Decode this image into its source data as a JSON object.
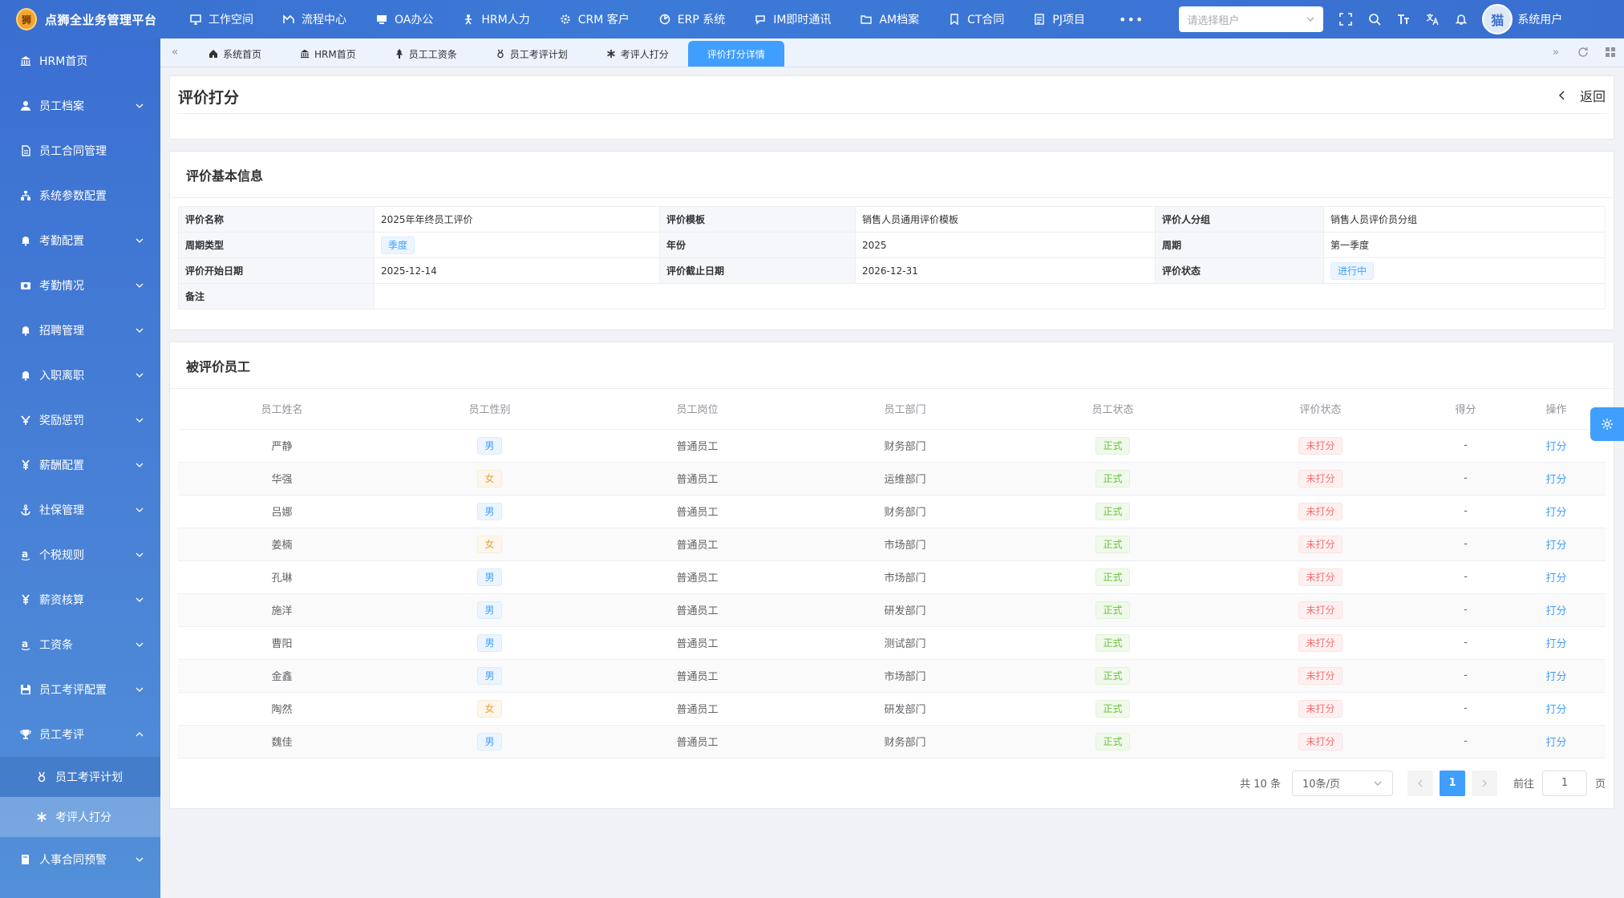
{
  "app": {
    "title": "点狮全业务管理平台",
    "logo_text": "狮"
  },
  "topnav": [
    {
      "icon": "monitor-icon",
      "label": "工作空间"
    },
    {
      "icon": "flow-icon",
      "label": "流程中心"
    },
    {
      "icon": "desktop-icon",
      "label": "OA办公"
    },
    {
      "icon": "person-icon",
      "label": "HRM人力"
    },
    {
      "icon": "gear-icon",
      "label": "CRM 客户"
    },
    {
      "icon": "chart-icon",
      "label": "ERP 系统"
    },
    {
      "icon": "chat-icon",
      "label": "IM即时通讯"
    },
    {
      "icon": "folder-icon",
      "label": "AM档案"
    },
    {
      "icon": "bookmark-icon",
      "label": "CT合同"
    },
    {
      "icon": "document-icon",
      "label": "PJ项目"
    }
  ],
  "more_label": "•••",
  "tenant": {
    "placeholder": "请选择租户"
  },
  "user": {
    "name": "系统用户",
    "avatar_text": "猫"
  },
  "sidebar": {
    "items": [
      {
        "icon": "bank-icon",
        "label": "HRM首页",
        "has_children": false
      },
      {
        "icon": "user-icon",
        "label": "员工档案",
        "has_children": true
      },
      {
        "icon": "file-icon",
        "label": "员工合同管理",
        "has_children": false
      },
      {
        "icon": "hierarchy-icon",
        "label": "系统参数配置",
        "has_children": false
      },
      {
        "icon": "bell-icon",
        "label": "考勤配置",
        "has_children": true
      },
      {
        "icon": "camera-icon",
        "label": "考勤情况",
        "has_children": true
      },
      {
        "icon": "bell-icon",
        "label": "招聘管理",
        "has_children": true
      },
      {
        "icon": "bell-icon",
        "label": "入职离职",
        "has_children": true
      },
      {
        "icon": "yen-v-icon",
        "label": "奖励惩罚",
        "has_children": true
      },
      {
        "icon": "yen-icon",
        "label": "薪酬配置",
        "has_children": true
      },
      {
        "icon": "anchor-icon",
        "label": "社保管理",
        "has_children": true
      },
      {
        "icon": "amazon-icon",
        "label": "个税规则",
        "has_children": true
      },
      {
        "icon": "yen-icon",
        "label": "薪资核算",
        "has_children": true
      },
      {
        "icon": "amazon-icon",
        "label": "工资条",
        "has_children": true
      },
      {
        "icon": "save-icon",
        "label": "员工考评配置",
        "has_children": true
      },
      {
        "icon": "trophy-icon",
        "label": "员工考评",
        "has_children": true,
        "expanded": true
      }
    ],
    "subitems": [
      {
        "icon": "medal-icon",
        "label": "员工考评计划"
      },
      {
        "icon": "asterisk-icon",
        "label": "考评人打分",
        "active": true
      }
    ],
    "last_item": {
      "icon": "book-icon",
      "label": "人事合同预警"
    }
  },
  "tabs": [
    {
      "icon": "home-icon",
      "label": "系统首页"
    },
    {
      "icon": "bank-icon",
      "label": "HRM首页"
    },
    {
      "icon": "tree-icon",
      "label": "员工工资条"
    },
    {
      "icon": "medal-icon",
      "label": "员工考评计划"
    },
    {
      "icon": "asterisk-icon",
      "label": "考评人打分"
    },
    {
      "icon": "",
      "label": "评价打分详情",
      "active": true
    }
  ],
  "page": {
    "title": "评价打分",
    "back_label": "返回"
  },
  "basic_info": {
    "section_title": "评价基本信息",
    "rows": [
      [
        {
          "label": "评价名称",
          "value": "2025年年终员工评价"
        },
        {
          "label": "评价模板",
          "value": "销售人员通用评价模板"
        },
        {
          "label": "评价人分组",
          "value": "销售人员评价员分组"
        }
      ],
      [
        {
          "label": "周期类型",
          "value": "季度",
          "tag": "blue"
        },
        {
          "label": "年份",
          "value": "2025"
        },
        {
          "label": "周期",
          "value": "第一季度"
        }
      ],
      [
        {
          "label": "评价开始日期",
          "value": "2025-12-14"
        },
        {
          "label": "评价截止日期",
          "value": "2026-12-31"
        },
        {
          "label": "评价状态",
          "value": "进行中",
          "tag": "blue"
        }
      ]
    ],
    "remark_label": "备注",
    "remark_value": ""
  },
  "employees": {
    "section_title": "被评价员工",
    "columns": [
      "员工姓名",
      "员工性别",
      "员工岗位",
      "员工部门",
      "员工状态",
      "评价状态",
      "得分",
      "操作"
    ],
    "rows": [
      {
        "name": "严静",
        "gender": "男",
        "post": "普通员工",
        "dept": "财务部门",
        "status": "正式",
        "eval": "未打分",
        "score": "-",
        "op": "打分"
      },
      {
        "name": "华强",
        "gender": "女",
        "post": "普通员工",
        "dept": "运维部门",
        "status": "正式",
        "eval": "未打分",
        "score": "-",
        "op": "打分"
      },
      {
        "name": "吕娜",
        "gender": "男",
        "post": "普通员工",
        "dept": "财务部门",
        "status": "正式",
        "eval": "未打分",
        "score": "-",
        "op": "打分"
      },
      {
        "name": "姜楠",
        "gender": "女",
        "post": "普通员工",
        "dept": "市场部门",
        "status": "正式",
        "eval": "未打分",
        "score": "-",
        "op": "打分"
      },
      {
        "name": "孔琳",
        "gender": "男",
        "post": "普通员工",
        "dept": "市场部门",
        "status": "正式",
        "eval": "未打分",
        "score": "-",
        "op": "打分"
      },
      {
        "name": "施洋",
        "gender": "男",
        "post": "普通员工",
        "dept": "研发部门",
        "status": "正式",
        "eval": "未打分",
        "score": "-",
        "op": "打分"
      },
      {
        "name": "曹阳",
        "gender": "男",
        "post": "普通员工",
        "dept": "测试部门",
        "status": "正式",
        "eval": "未打分",
        "score": "-",
        "op": "打分"
      },
      {
        "name": "金鑫",
        "gender": "男",
        "post": "普通员工",
        "dept": "市场部门",
        "status": "正式",
        "eval": "未打分",
        "score": "-",
        "op": "打分"
      },
      {
        "name": "陶然",
        "gender": "女",
        "post": "普通员工",
        "dept": "研发部门",
        "status": "正式",
        "eval": "未打分",
        "score": "-",
        "op": "打分"
      },
      {
        "name": "魏佳",
        "gender": "男",
        "post": "普通员工",
        "dept": "财务部门",
        "status": "正式",
        "eval": "未打分",
        "score": "-",
        "op": "打分"
      }
    ]
  },
  "pagination": {
    "total_label": "共 10 条",
    "page_size": "10条/页",
    "current_page": "1",
    "goto_prefix": "前往",
    "goto_value": "1",
    "goto_suffix": "页"
  },
  "colors": {
    "primary": "#409eff",
    "topbar": "#3a6fd0",
    "success": "#67c23a",
    "danger": "#f56c6c",
    "warning": "#e6a23c"
  }
}
